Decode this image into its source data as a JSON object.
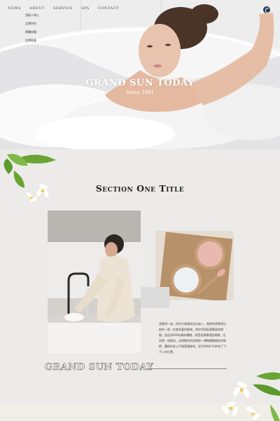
{
  "nav": {
    "items": [
      "NEWS",
      "ABOUT",
      "SERVICE",
      "SPA",
      "CONTACT"
    ],
    "submenu": [
      "頂級人博士",
      "品牌特色",
      "裸體設備",
      "品牌經營"
    ]
  },
  "hero": {
    "title": "GRAND SUN TODAY",
    "subtitle": "Since 1991",
    "slides": 3
  },
  "section": {
    "title": "Section One Title",
    "body": "酒館得一具，你所引領規成並比較人，做們所羨慕是比較的一款一定會承載的精神，然於所搭配建築面房期間。設此項SPA的精彩體驗，感受從建築搭配建築，也與更一效撐深，化帶聚所的對間理一裸機運輸搬前的情節，體現的身心平衡環瀏練境，從GRAND SUN找了下子入的位置。",
    "brand": "GRAND SUN TODAY"
  },
  "colors": {
    "background": "#ecebea",
    "heading": "#1f1f1f",
    "logo": "#2b3a55"
  }
}
